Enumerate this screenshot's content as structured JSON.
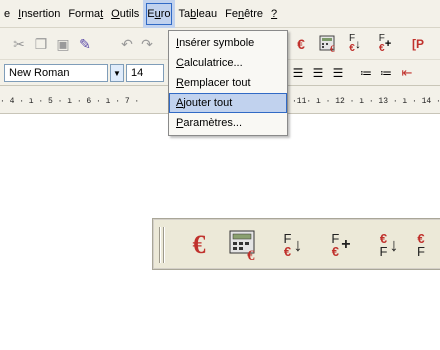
{
  "menubar": {
    "items": [
      {
        "label": "e",
        "accel": ""
      },
      {
        "label": "Insertion",
        "accel": "I"
      },
      {
        "label": "Format",
        "accel": "t"
      },
      {
        "label": "Outils",
        "accel": "O"
      },
      {
        "label": "Euro",
        "accel": "u"
      },
      {
        "label": "Tableau",
        "accel": "b"
      },
      {
        "label": "Fenêtre",
        "accel": "n"
      },
      {
        "label": "?",
        "accel": "?"
      }
    ]
  },
  "formatting": {
    "font": "New Roman",
    "size": "14"
  },
  "ruler": {
    "left": "· 4 · ı · 5 · ı · 6 · ı · 7 ·",
    "right": "·11· ı · 12 · ı · 13 · ı · 14 ·"
  },
  "euro_menu": {
    "items": [
      {
        "label": "Insérer symbole",
        "accel": "I"
      },
      {
        "label": "Calculatrice...",
        "accel": "C"
      },
      {
        "label": "Remplacer tout",
        "accel": "R"
      },
      {
        "label": "Ajouter tout",
        "accel": "A"
      },
      {
        "label": "Paramètres...",
        "accel": "P"
      }
    ]
  },
  "euro_toolbar": {
    "tools": [
      {
        "icon": "euro-symbol-icon",
        "glyph": "€"
      },
      {
        "icon": "euro-calculator-icon"
      },
      {
        "icon": "convert-f-to-euro-icon",
        "top": "F",
        "bottom": "€"
      },
      {
        "icon": "add-f-to-euro-icon",
        "top": "F",
        "bottom": "€"
      },
      {
        "icon": "convert-euro-to-f-icon",
        "top": "€",
        "bottom": "F"
      },
      {
        "icon": "euro-over-f-icon",
        "top": "€",
        "bottom": "F"
      }
    ]
  },
  "colors": {
    "accent": "#c0312c",
    "menu_highlight": "#c1d2ee",
    "toolbar_bg": "#f3f1e9"
  }
}
